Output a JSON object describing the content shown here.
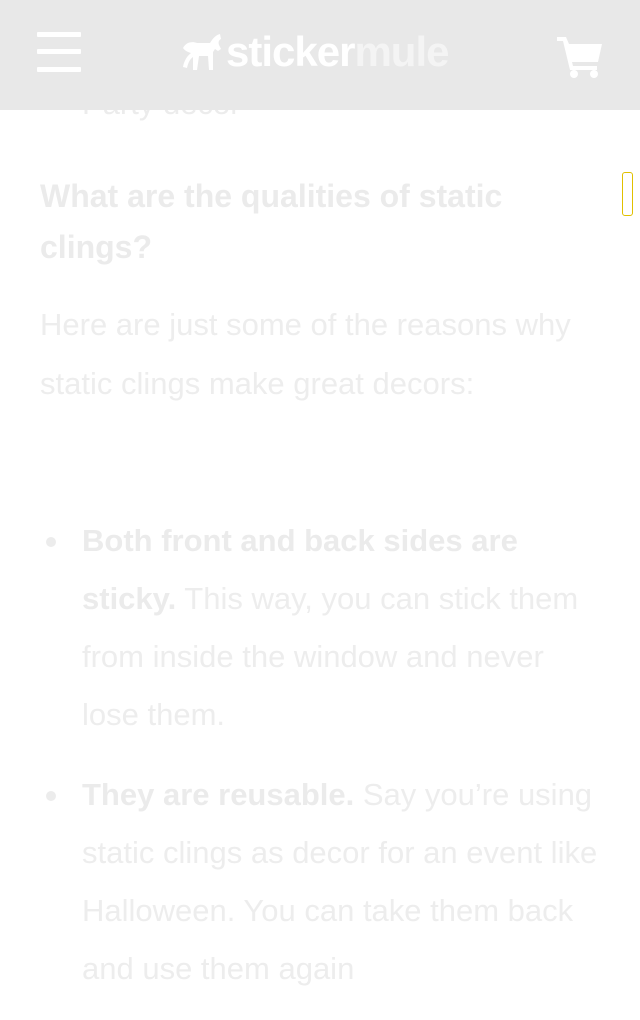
{
  "header": {
    "logo_text_a": "sticker",
    "logo_text_b": "mule",
    "logo_mark": "horse-logo-icon",
    "menu_icon": "hamburger-menu-icon",
    "cart_icon": "shopping-cart-icon"
  },
  "article": {
    "partial_item": "Party decor",
    "heading": "What are the qualities of static clings?",
    "intro": "Here are just some of the reasons why static clings make great decors:",
    "list": [
      {
        "bold": "Both front and back sides are sticky.",
        "text": " This way, you can stick them from inside the window and never lose them."
      },
      {
        "bold": "They are reusable.",
        "text": " Say you’re using static clings as decor for an event like Halloween. You can take them back and use them again"
      }
    ]
  },
  "colors": {
    "header_bg": "#e8e8e8",
    "text_faded": "#ececec",
    "scroll_indicator_border": "#e0c000"
  }
}
